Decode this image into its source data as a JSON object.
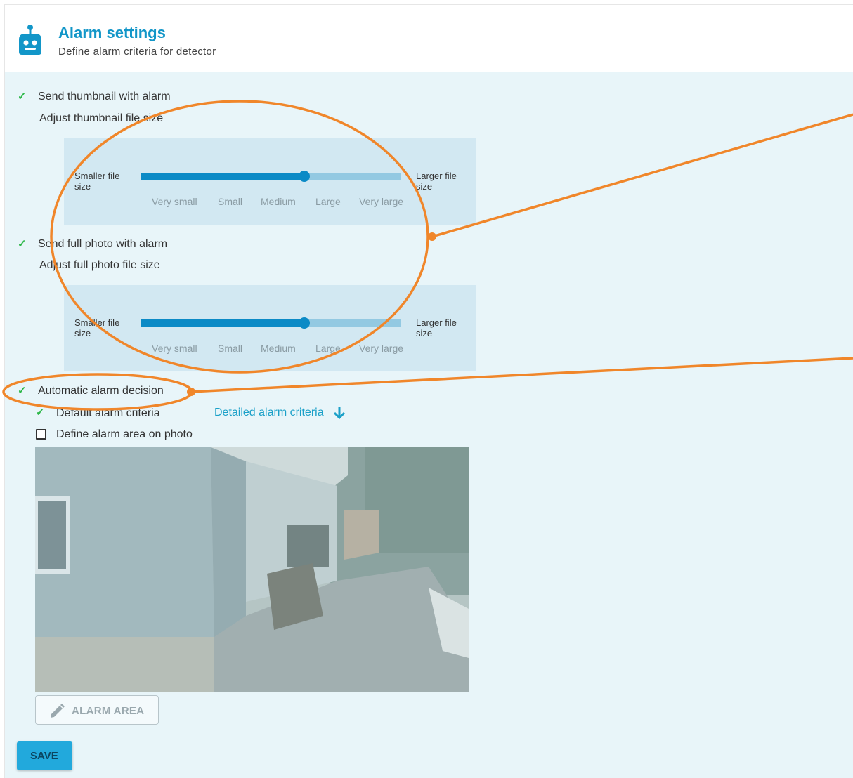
{
  "header": {
    "title": "Alarm settings",
    "subtitle": "Define alarm criteria for detector",
    "icon": "robot-icon"
  },
  "thumbnail": {
    "checkbox_label": "Send thumbnail with alarm",
    "checked": true,
    "adjust_label": "Adjust thumbnail file size",
    "slider": {
      "left_label": "Smaller file size",
      "right_label": "Larger file size",
      "ticks": [
        "Very small",
        "Small",
        "Medium",
        "Large",
        "Very large"
      ],
      "selected": "Medium"
    }
  },
  "full_photo": {
    "checkbox_label": "Send full photo with alarm",
    "checked": true,
    "adjust_label": "Adjust full photo file size",
    "slider": {
      "left_label": "Smaller file size",
      "right_label": "Larger file size",
      "ticks": [
        "Very small",
        "Small",
        "Medium",
        "Large",
        "Very large"
      ],
      "selected": "Medium"
    }
  },
  "automatic": {
    "checkbox_label": "Automatic alarm decision",
    "checked": true,
    "default_label": "Default alarm criteria",
    "default_checked": true,
    "detailed_link": "Detailed alarm criteria",
    "define_area_label": "Define alarm area on photo",
    "define_area_checked": false
  },
  "buttons": {
    "alarm_area": "ALARM AREA",
    "save": "SAVE"
  },
  "colors": {
    "accent": "#1296c8",
    "panel_bg": "#e8f5f9",
    "slider_bg": "#d2e8f2",
    "check": "#2fb84a",
    "annotation": "#f0862a"
  }
}
